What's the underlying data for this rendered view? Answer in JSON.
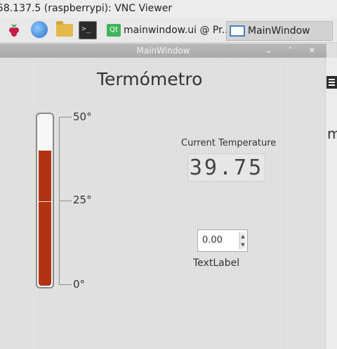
{
  "vnc": {
    "title": "58.137.5 (raspberrypi): VNC Viewer"
  },
  "taskbar": {
    "tasks": [
      {
        "label": "mainwindow.ui @ Pr..."
      },
      {
        "label": "MainWindow"
      }
    ]
  },
  "window": {
    "title": "MainWindow",
    "controls": "⌄ ˄ ✕"
  },
  "heading": "Termómetro",
  "thermometer": {
    "scale": {
      "max_label": "50°",
      "mid_label": "25°",
      "min_label": "0°",
      "min": 0,
      "max": 50
    },
    "value": 39.75,
    "fill_color": "#b23312"
  },
  "current_temperature": {
    "label": "Current Temperature",
    "display": "39.75"
  },
  "spinbox": {
    "value": "0.00"
  },
  "text_label": "TextLabel",
  "edge_text": "m"
}
